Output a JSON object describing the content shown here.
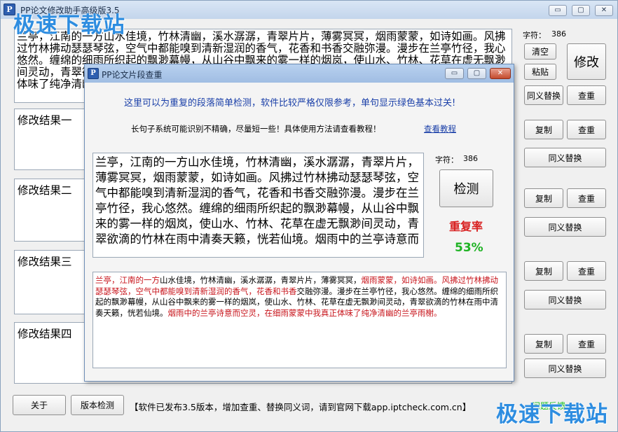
{
  "window": {
    "title": "PP论文修改助手高级版3.5",
    "controls": [
      "▭",
      "▢",
      "✕"
    ]
  },
  "watermark": "极速下载站",
  "source": {
    "text": "兰亭，江南的一方山水佳境，竹林清幽，溪水潺潺，青翠片片，薄雾冥冥，烟雨蒙蒙，如诗如画。风拂过竹林拂动瑟瑟琴弦，空气中都能嗅到清新湿润的香气，花香和书香交融弥漫。漫步在兰亭竹径，我心悠然。缠绵的细雨所织起的飘渺幕幔，从山谷中飘来的雾一样的烟岚，使山水、竹林、花草在虚无飘渺间灵动，青翠欲滴的竹林在雨中清奏天籁，恍若仙境。烟雨中的兰亭诗意而空灵，在细雨蒙蒙中我真正体味了纯净清幽的兰亭雨榭。",
    "char_count_label": "字符：",
    "char_count": "386"
  },
  "results": [
    {
      "label": "修改结果一"
    },
    {
      "label": "修改结果二"
    },
    {
      "label": "修改结果三"
    },
    {
      "label": "修改结果四"
    }
  ],
  "buttons": {
    "clear": "清空",
    "paste": "粘贴",
    "modify": "修改",
    "synonym": "同义替换",
    "check": "查重",
    "copy": "复制",
    "about": "关于",
    "version_check": "版本检测"
  },
  "footer": {
    "notice": "【软件已发布3.5版本，增加查重、替换同义词，请到官网下载app.iptcheck.com.cn】",
    "link": "问题反馈"
  },
  "dialog": {
    "title": "PP论文片段查重",
    "controls": [
      "▭",
      "▢",
      "✕"
    ],
    "notice": "这里可以为重复的段落简单检测，软件比较严格仅限参考，单句显示绿色基本过关!",
    "hint": "长句子系统可能识别不精确，尽量短一些！具体使用方法请查看教程！",
    "tutorial_link": "查看教程",
    "char_count_label": "字符：",
    "char_count": "386",
    "detect_button": "检测",
    "rate_label": "重复率",
    "rate_value": "53%",
    "input_text": "兰亭，江南的一方山水佳境，竹林清幽，溪水潺潺，青翠片片，薄雾冥冥，烟雨蒙蒙，如诗如画。风拂过竹林拂动瑟瑟琴弦，空气中都能嗅到清新湿润的香气，花香和书香交融弥漫。漫步在兰亭竹径，我心悠然。缠绵的细雨所织起的飘渺幕幔，从山谷中飘来的雾一样的烟岚，使山水、竹林、花草在虚无飘渺间灵动，青翠欲滴的竹林在雨中清奏天籁，恍若仙境。烟雨中的兰亭诗意而",
    "result_segments": [
      {
        "text": "兰亭，江南的一方",
        "dup": true
      },
      {
        "text": "山水佳境，竹林清幽，溪水潺潺，青翠片片，薄雾冥冥，",
        "dup": false
      },
      {
        "text": "烟雨蒙蒙，如诗如画。风拂过竹林拂动瑟瑟琴弦，空气中都能嗅到清新湿润的香气，花香和书香",
        "dup": true
      },
      {
        "text": "交融弥漫。漫步在兰亭竹径，我心悠然。缠绵的细雨所织起的飘渺幕幔，从山谷中飘来的雾一样的烟岚，使山水、竹林、花草在虚无飘渺间灵动，青翠欲滴的竹林在雨中清奏天籁，恍若仙境。",
        "dup": false
      },
      {
        "text": "烟雨中的兰亭诗意而空灵，在细雨蒙蒙中我真正体味了纯净清幽的兰亭雨榭。",
        "dup": true
      }
    ]
  },
  "colors": {
    "duplicate": "#c8161d",
    "pass": "#1fb324",
    "link": "#1a3fa8"
  }
}
